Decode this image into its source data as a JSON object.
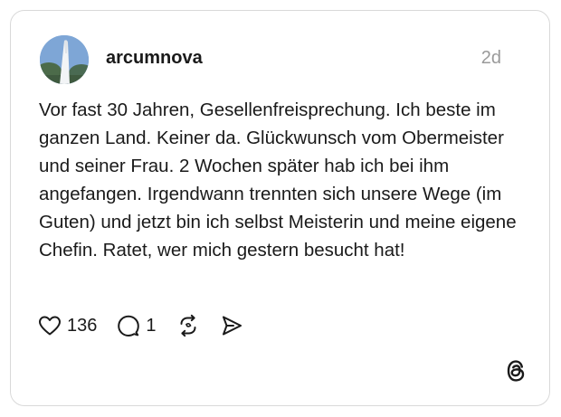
{
  "post": {
    "username": "arcumnova",
    "timestamp": "2d",
    "text": "Vor fast 30 Jahren, Gesellenfreisprechung. Ich beste im ganzen Land. Keiner da. Glückwunsch vom Obermeister und seiner Frau. 2 Wochen später hab ich bei ihm angefangen. Irgendwann trennten sich unsere Wege (im Guten) und jetzt bin ich selbst Meisterin und meine eigene Chefin. Ratet, wer mich gestern besucht hat!",
    "likes": "136",
    "replies": "1"
  },
  "icons": {
    "like": "heart-icon",
    "reply": "speech-bubble-icon",
    "repost": "repost-icon",
    "share": "send-icon",
    "brand": "threads-logo-icon"
  },
  "colors": {
    "text": "#1a1a1a",
    "muted": "#9a9a9a",
    "border": "#d9d9d9"
  }
}
